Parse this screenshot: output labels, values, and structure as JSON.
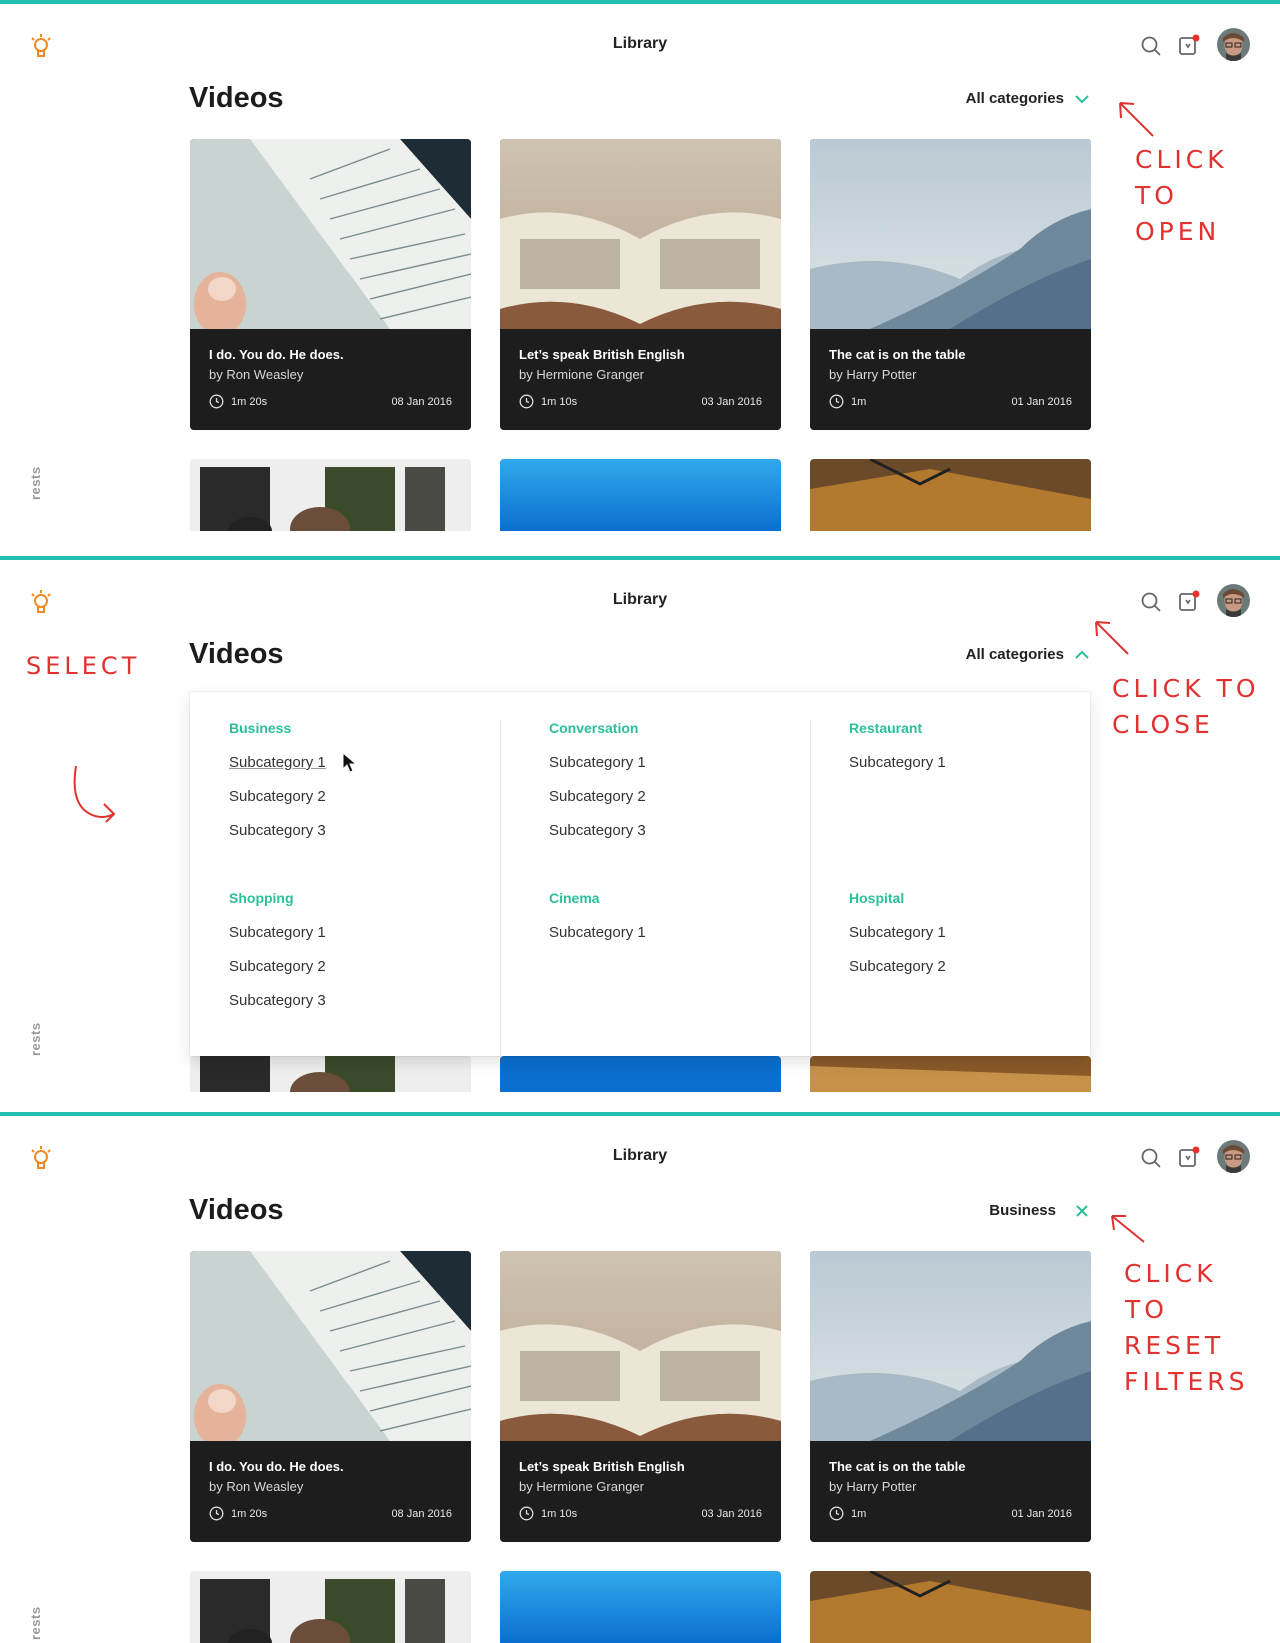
{
  "app": {
    "title": "Library",
    "rail_label": "rests",
    "accent": "#21c0b0",
    "logo_icon": "lightbulb-icon"
  },
  "page": {
    "title": "Videos",
    "filter_label": "All categories",
    "filter_active_label": "Business"
  },
  "cards": [
    {
      "title": "I do. You do. He does.",
      "author": "by Ron Weasley",
      "duration": "1m 20s",
      "date": "08 Jan 2016"
    },
    {
      "title": "Let’s speak British English",
      "author": "by Hermione Granger",
      "duration": "1m 10s",
      "date": "03 Jan 2016"
    },
    {
      "title": "The cat is on the table",
      "author": "by Harry Potter",
      "duration": "1m",
      "date": "01 Jan 2016"
    }
  ],
  "dropdown": {
    "groups": [
      {
        "name": "Business",
        "items": [
          "Subcategory 1",
          "Subcategory 2",
          "Subcategory 3"
        ]
      },
      {
        "name": "Conversation",
        "items": [
          "Subcategory 1",
          "Subcategory 2",
          "Subcategory 3"
        ]
      },
      {
        "name": "Restaurant",
        "items": [
          "Subcategory 1"
        ]
      },
      {
        "name": "Shopping",
        "items": [
          "Subcategory 1",
          "Subcategory 2",
          "Subcategory 3"
        ]
      },
      {
        "name": "Cinema",
        "items": [
          "Subcategory 1"
        ]
      },
      {
        "name": "Hospital",
        "items": [
          "Subcategory 1",
          "Subcategory 2"
        ]
      }
    ],
    "group_color": "#2cc09a"
  },
  "annotations": {
    "open": [
      "CLICK TO",
      "OPEN"
    ],
    "select": "SELECT",
    "close": [
      "CLICK TO",
      "CLOSE"
    ],
    "reset": [
      "CLICK",
      "TO",
      "RESET",
      "FILTERS"
    ],
    "color": "#e0322f"
  }
}
